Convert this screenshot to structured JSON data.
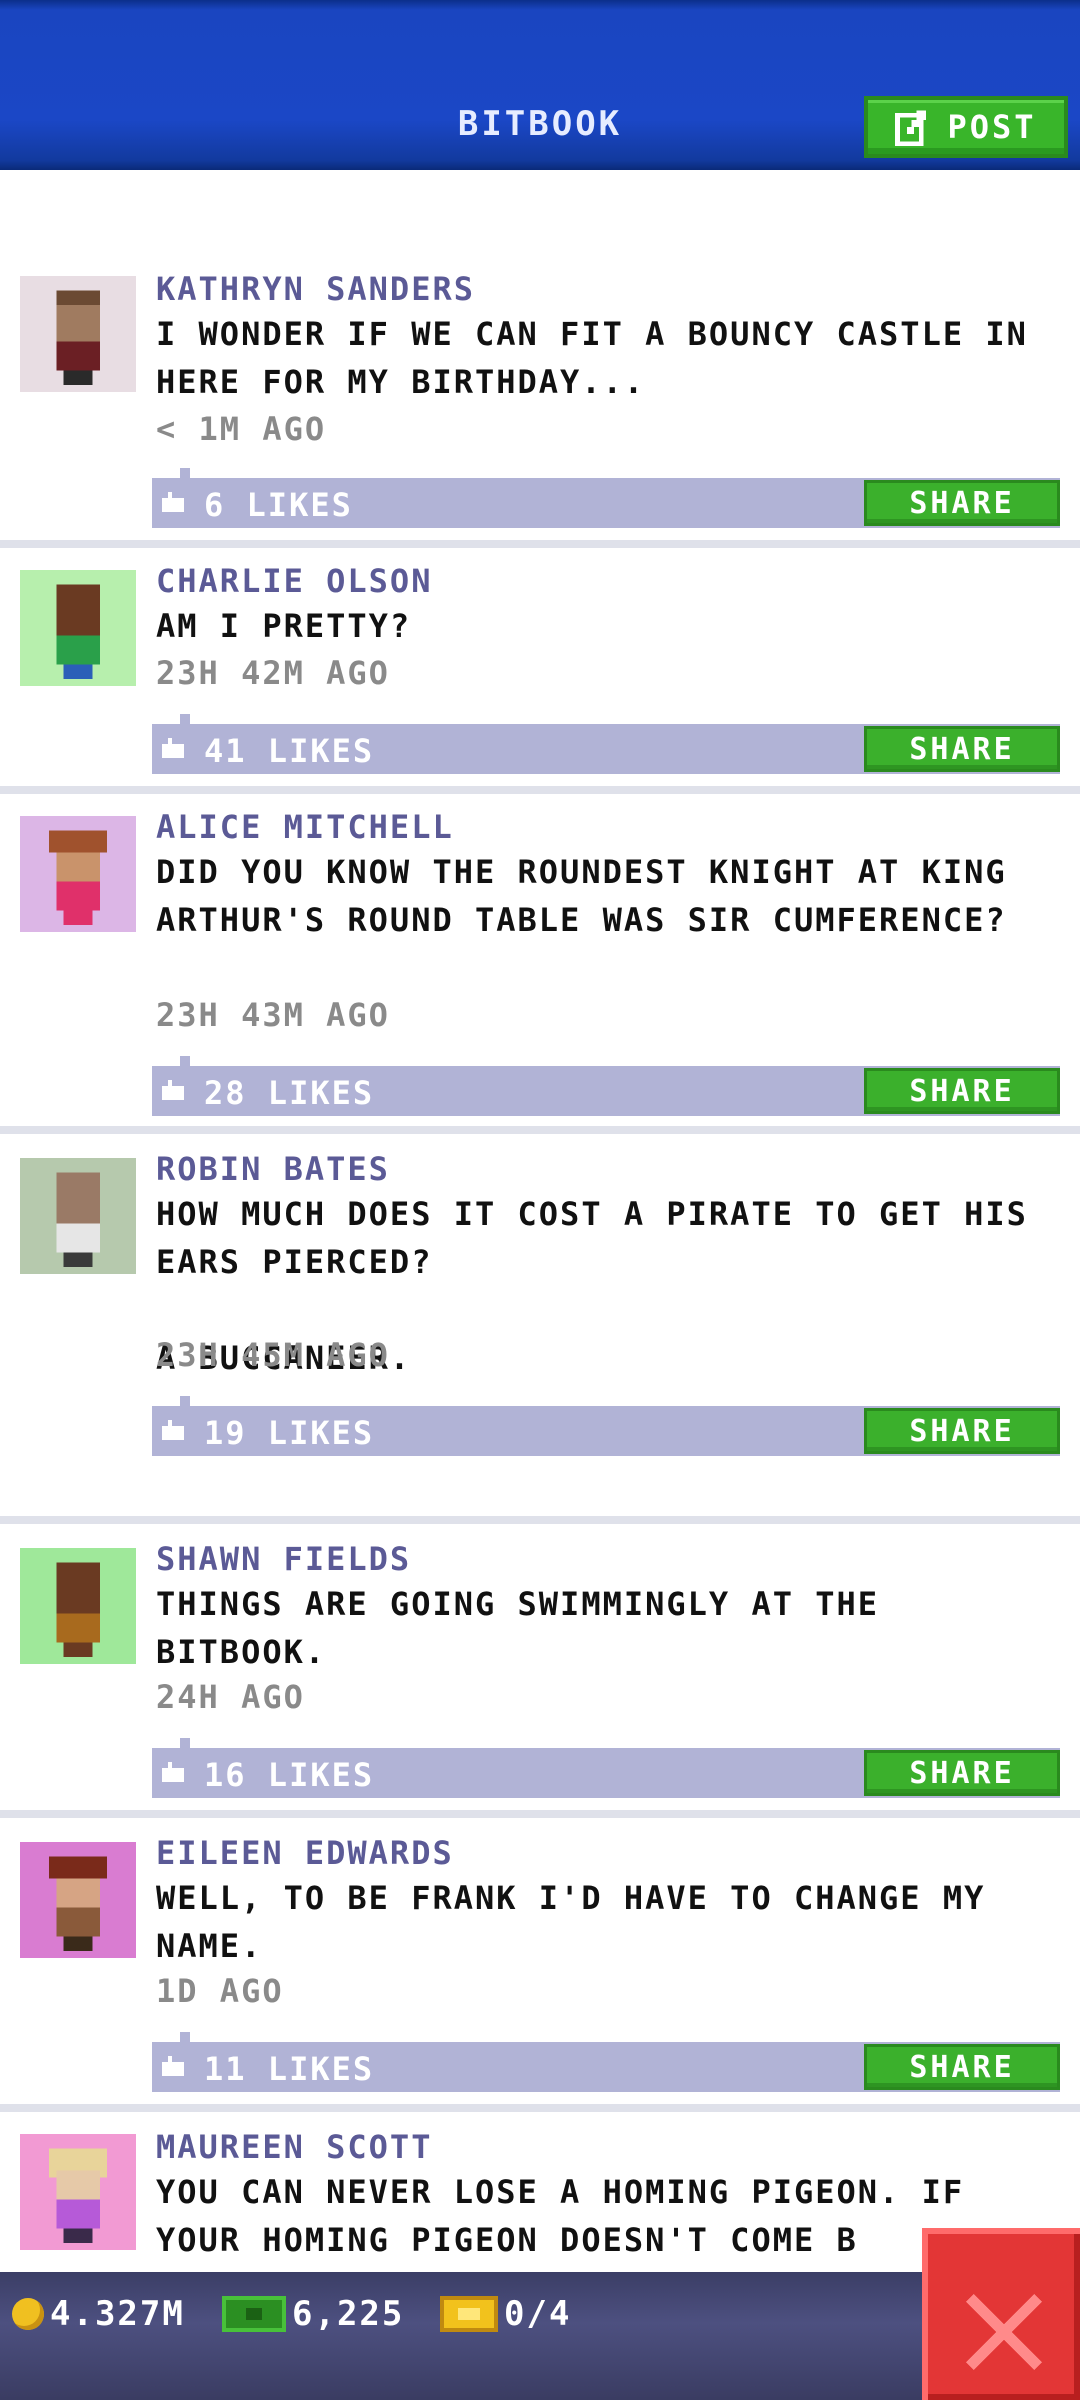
{
  "header": {
    "title": "BITBOOK",
    "post_label": "POST",
    "post_icon": "edit-icon"
  },
  "posts": [
    {
      "author": "KATHRYN SANDERS",
      "message": "I WONDER IF WE CAN FIT A BOUNCY CASTLE IN HERE FOR MY BIRTHDAY...",
      "time": "< 1M AGO",
      "likes": "6 LIKES",
      "share": "SHARE",
      "avatar_bg": "#e8dde3"
    },
    {
      "author": "CHARLIE OLSON",
      "message": "AM I PRETTY?",
      "time": "23H 42M AGO",
      "likes": "41 LIKES",
      "share": "SHARE",
      "avatar_bg": "#b7efad"
    },
    {
      "author": "ALICE MITCHELL",
      "message": "DID YOU KNOW THE ROUNDEST KNIGHT AT KING ARTHUR'S ROUND TABLE WAS SIR CUMFERENCE?",
      "time": "23H 43M AGO",
      "likes": "28 LIKES",
      "share": "SHARE",
      "avatar_bg": "#dcb6e6"
    },
    {
      "author": "ROBIN BATES",
      "message": "HOW MUCH DOES IT COST A PIRATE TO GET HIS EARS PIERCED?\n\nA BUCCANEER.",
      "time": "23H 45M AGO",
      "likes": "19 LIKES",
      "share": "SHARE",
      "avatar_bg": "#b6c9ad"
    },
    {
      "author": "SHAWN FIELDS",
      "message": "THINGS ARE GOING SWIMMINGLY AT THE BITBOOK.",
      "time": "24H AGO",
      "likes": "16 LIKES",
      "share": "SHARE",
      "avatar_bg": "#9fe89a"
    },
    {
      "author": "EILEEN EDWARDS",
      "message": "WELL, TO BE FRANK I'D HAVE TO CHANGE MY NAME.",
      "time": "1D AGO",
      "likes": "11 LIKES",
      "share": "SHARE",
      "avatar_bg": "#d97cd1"
    },
    {
      "author": "MAUREEN SCOTT",
      "message": "YOU CAN NEVER LOSE A HOMING PIGEON. IF YOUR HOMING PIGEON DOESN'T COME B",
      "time": "",
      "likes": "",
      "share": "",
      "avatar_bg": "#f29ad3"
    }
  ],
  "footer": {
    "coins": "4.327M",
    "bux": "6,225",
    "tickets": "0/4"
  },
  "colors": {
    "header_blue": "#1b47c6",
    "share_green": "#3bb02c",
    "like_bar": "#b1b3d6",
    "author_purple": "#5b5a96",
    "close_red": "#e33636"
  }
}
